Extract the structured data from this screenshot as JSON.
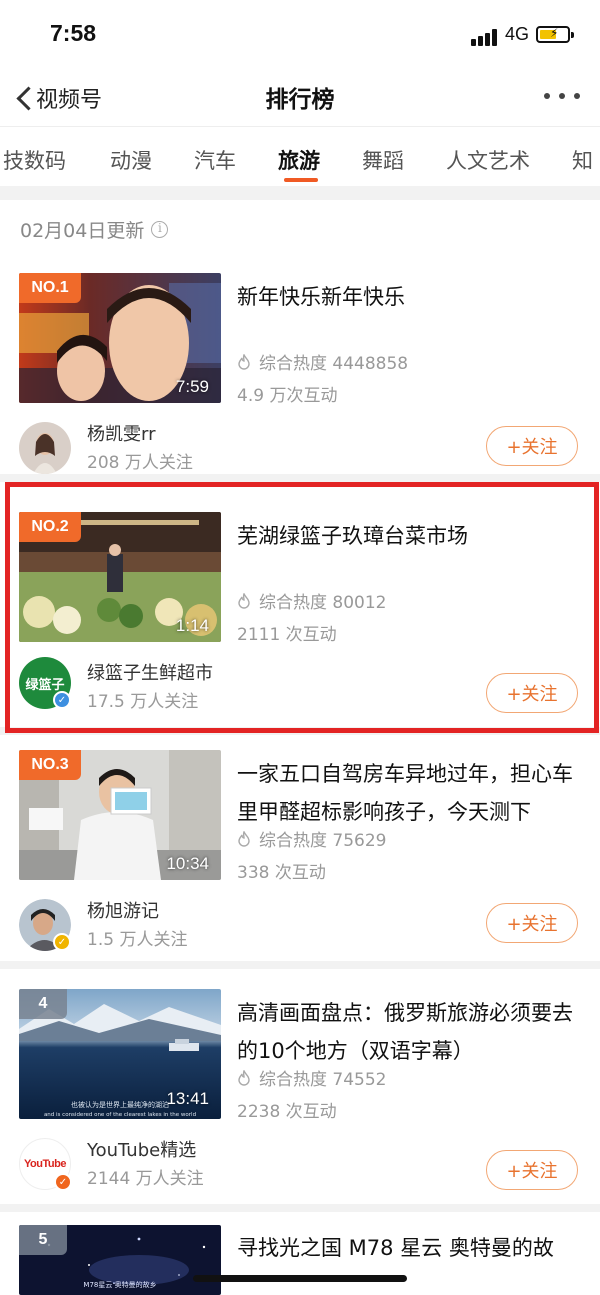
{
  "status_bar": {
    "time": "7:58",
    "network": "4G"
  },
  "nav": {
    "back_label": "视频号",
    "title": "排行榜"
  },
  "tabs": [
    {
      "label": "技数码"
    },
    {
      "label": "动漫"
    },
    {
      "label": "汽车"
    },
    {
      "label": "旅游",
      "active": true
    },
    {
      "label": "舞蹈"
    },
    {
      "label": "人文艺术"
    },
    {
      "label": "知"
    }
  ],
  "update_text": "02月04日更新",
  "items": [
    {
      "rank": "NO.1",
      "duration": "7:59",
      "title": "新年快乐新年快乐",
      "heat": "综合热度 4448858",
      "interactions": "4.9 万次互动",
      "author": "杨凯雯rr",
      "followers": "208 万人关注",
      "follow_label": "+关注"
    },
    {
      "rank": "NO.2",
      "duration": "1:14",
      "title": "芜湖绿篮子玖璋台菜市场",
      "heat": "综合热度 80012",
      "interactions": "2111 次互动",
      "author": "绿篮子生鲜超市",
      "followers": "17.5 万人关注",
      "follow_label": "+关注",
      "avatar_text": "绿篮子"
    },
    {
      "rank": "NO.3",
      "duration": "10:34",
      "title": "一家五口自驾房车异地过年，担心车里甲醛超标影响孩子，今天测下",
      "heat": "综合热度 75629",
      "interactions": "338 次互动",
      "author": "杨旭游记",
      "followers": "1.5 万人关注",
      "follow_label": "+关注"
    },
    {
      "rank": "4",
      "duration": "13:41",
      "title": "高清画面盘点：俄罗斯旅游必须要去的10个地方（双语字幕）",
      "heat": "综合热度 74552",
      "interactions": "2238 次互动",
      "author": "YouTube精选",
      "followers": "2144 万人关注",
      "follow_label": "+关注",
      "avatar_text": "YouTube",
      "subtitle_line1": "也被认为是世界上最纯净的湖泊",
      "subtitle_line2": "and is considered one of the clearest lakes in the world"
    },
    {
      "rank": "5",
      "title": "寻找光之国 M78 星云 奥特曼的故",
      "thumb_text": "M78星云 奥特曼的故乡"
    }
  ],
  "colors": {
    "accent": "#f05a24",
    "highlight": "#e32424",
    "follow": "#e8732f"
  }
}
